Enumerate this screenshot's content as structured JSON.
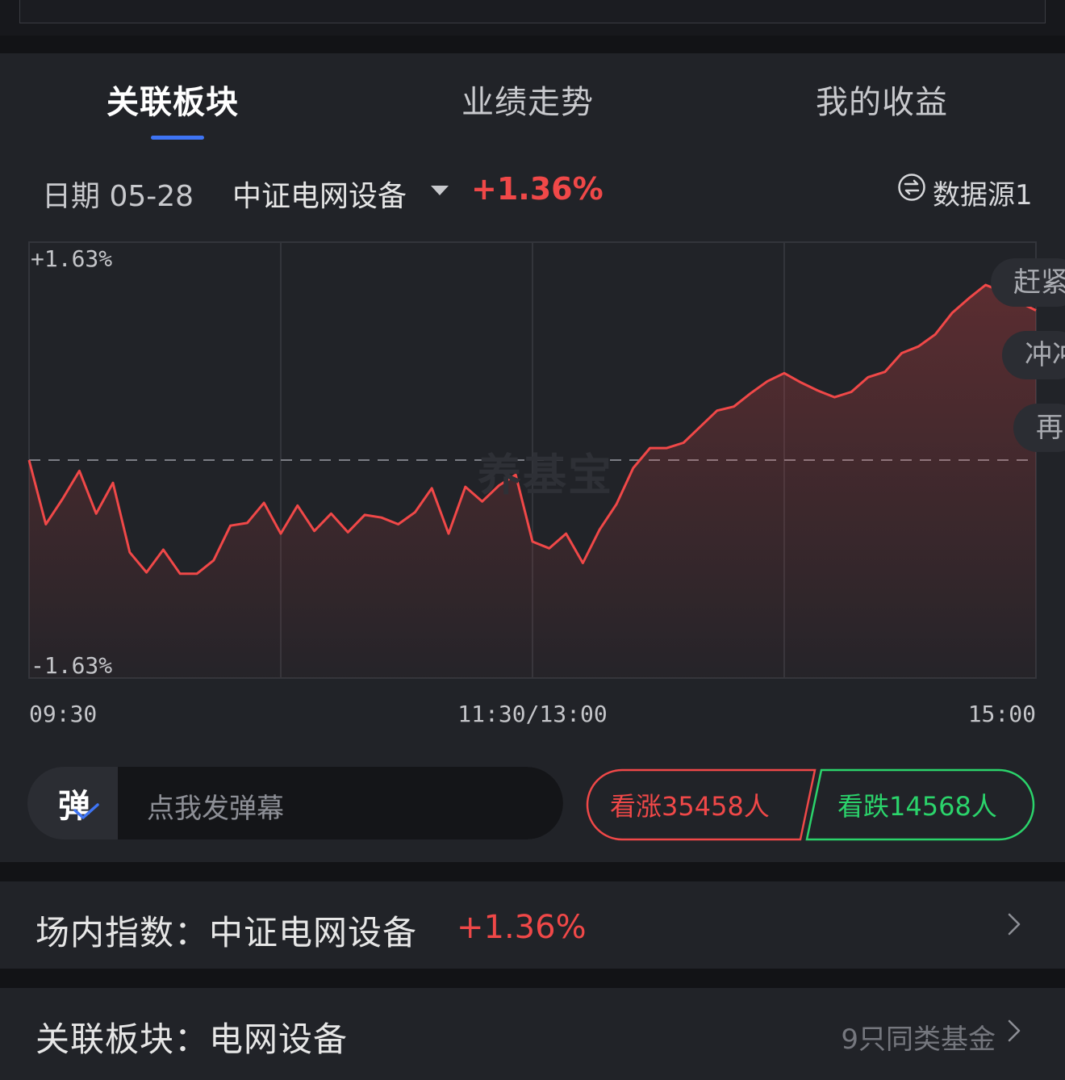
{
  "top_banner": {
    "text": ""
  },
  "tabs": [
    {
      "label": "关联板块",
      "active": true
    },
    {
      "label": "业绩走势",
      "active": false
    },
    {
      "label": "我的收益",
      "active": false
    }
  ],
  "info": {
    "date_label": "日期 05-28",
    "index_name": "中证电网设备",
    "change": "+1.36%",
    "data_source": "数据源1"
  },
  "chart_data": {
    "type": "line",
    "title": "",
    "ylabel_top": "+1.63%",
    "ylabel_bottom": "-1.63%",
    "ylim": [
      -1.63,
      1.63
    ],
    "baseline": 0,
    "x_tick_labels": [
      "09:30",
      "11:30/13:00",
      "15:00"
    ],
    "grid": true,
    "watermark": "养基宝",
    "line_color": "#f04848",
    "series": [
      {
        "x": [
          0,
          4,
          8,
          12,
          16,
          20,
          24,
          28,
          32,
          36,
          40,
          44,
          48,
          52,
          56,
          60,
          64,
          68,
          72,
          76,
          80,
          84,
          88,
          92,
          96,
          100,
          104,
          108,
          112,
          116,
          120,
          124,
          128,
          132,
          136,
          140,
          144,
          148,
          152,
          156,
          160,
          164,
          168,
          172,
          176,
          180,
          184,
          188,
          192,
          196,
          200,
          204,
          208,
          212,
          216,
          220,
          224,
          228,
          232,
          236,
          240
        ],
        "values": [
          0.0,
          -0.48,
          -0.29,
          -0.08,
          -0.4,
          -0.17,
          -0.69,
          -0.84,
          -0.67,
          -0.85,
          -0.85,
          -0.75,
          -0.49,
          -0.47,
          -0.32,
          -0.55,
          -0.34,
          -0.53,
          -0.4,
          -0.54,
          -0.41,
          -0.43,
          -0.48,
          -0.39,
          -0.21,
          -0.55,
          -0.2,
          -0.31,
          -0.19,
          -0.11,
          -0.61,
          -0.66,
          -0.55,
          -0.77,
          -0.52,
          -0.33,
          -0.06,
          0.09,
          0.09,
          0.13,
          0.25,
          0.37,
          0.4,
          0.5,
          0.59,
          0.65,
          0.58,
          0.52,
          0.47,
          0.51,
          0.62,
          0.66,
          0.8,
          0.85,
          0.94,
          1.1,
          1.21,
          1.31,
          1.26,
          1.18,
          1.12
        ]
      }
    ]
  },
  "danmaku": [
    {
      "text": "赶紧"
    },
    {
      "text": "冲冲"
    },
    {
      "text": "再"
    },
    {
      "text": ""
    }
  ],
  "barrage": {
    "badge": "弹",
    "placeholder": "点我发弹幕"
  },
  "vote": {
    "up_label": "看涨35458人",
    "down_label": "看跌14568人",
    "up_color": "#f04848",
    "down_color": "#2bd36b"
  },
  "rows": {
    "index_row": {
      "label": "场内指数：中证电网设备",
      "change": "+1.36%"
    },
    "sector_row": {
      "label": "关联板块：电网设备",
      "meta": "9只同类基金"
    }
  }
}
